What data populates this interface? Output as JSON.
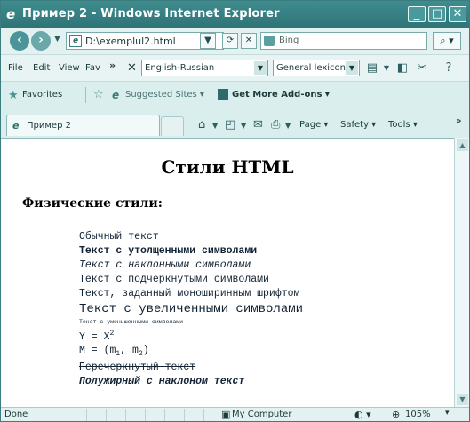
{
  "window": {
    "title": "Пример 2 - Windows Internet Explorer",
    "ie_logo": "e",
    "buttons": {
      "minimize": "_",
      "maximize": "□",
      "close": "✕"
    }
  },
  "address": {
    "url": "D:\\exemplul2.html",
    "page_icon": "e",
    "search_placeholder": "Bing"
  },
  "menu": {
    "file": "File",
    "edit": "Edit",
    "view": "View",
    "favorites": "Fav",
    "more": "»",
    "close_x": "✕",
    "language": "English-Russian",
    "lexicon": "General lexicon"
  },
  "favorites_bar": {
    "favorites": "Favorites",
    "suggested_sites": "Suggested Sites ▾",
    "get_addons": "Get More Add-ons ▾"
  },
  "tab": {
    "label": "Пример 2",
    "icon": "e"
  },
  "commands": {
    "page": "Page ▾",
    "safety": "Safety ▾",
    "tools": "Tools ▾",
    "more": "»"
  },
  "content": {
    "title": "Стили HTML",
    "subtitle": "Физические стили:",
    "lines": {
      "normal": "Обычный текст",
      "bold": "Текст с утолщенными символами",
      "italic": "Текст с наклонными символами",
      "underline": "Текст с подчеркнутыми символами",
      "mono": "Текст, заданный моноширинным шрифтом",
      "big": "Текст с увеличенными символами",
      "small": "Текст с уменьшенными символами",
      "sup_base": "Y = X",
      "sup_exp": "2",
      "sub_prefix": "M = (m",
      "sub_1": "1",
      "sub_mid": ", m",
      "sub_2": "2",
      "sub_suffix": ")",
      "strike": "Перечеркнутый текст",
      "bold_italic": "Полужирный с наклоном текст"
    }
  },
  "status": {
    "done": "Done",
    "zone": "My Computer",
    "zoom": "105%"
  }
}
